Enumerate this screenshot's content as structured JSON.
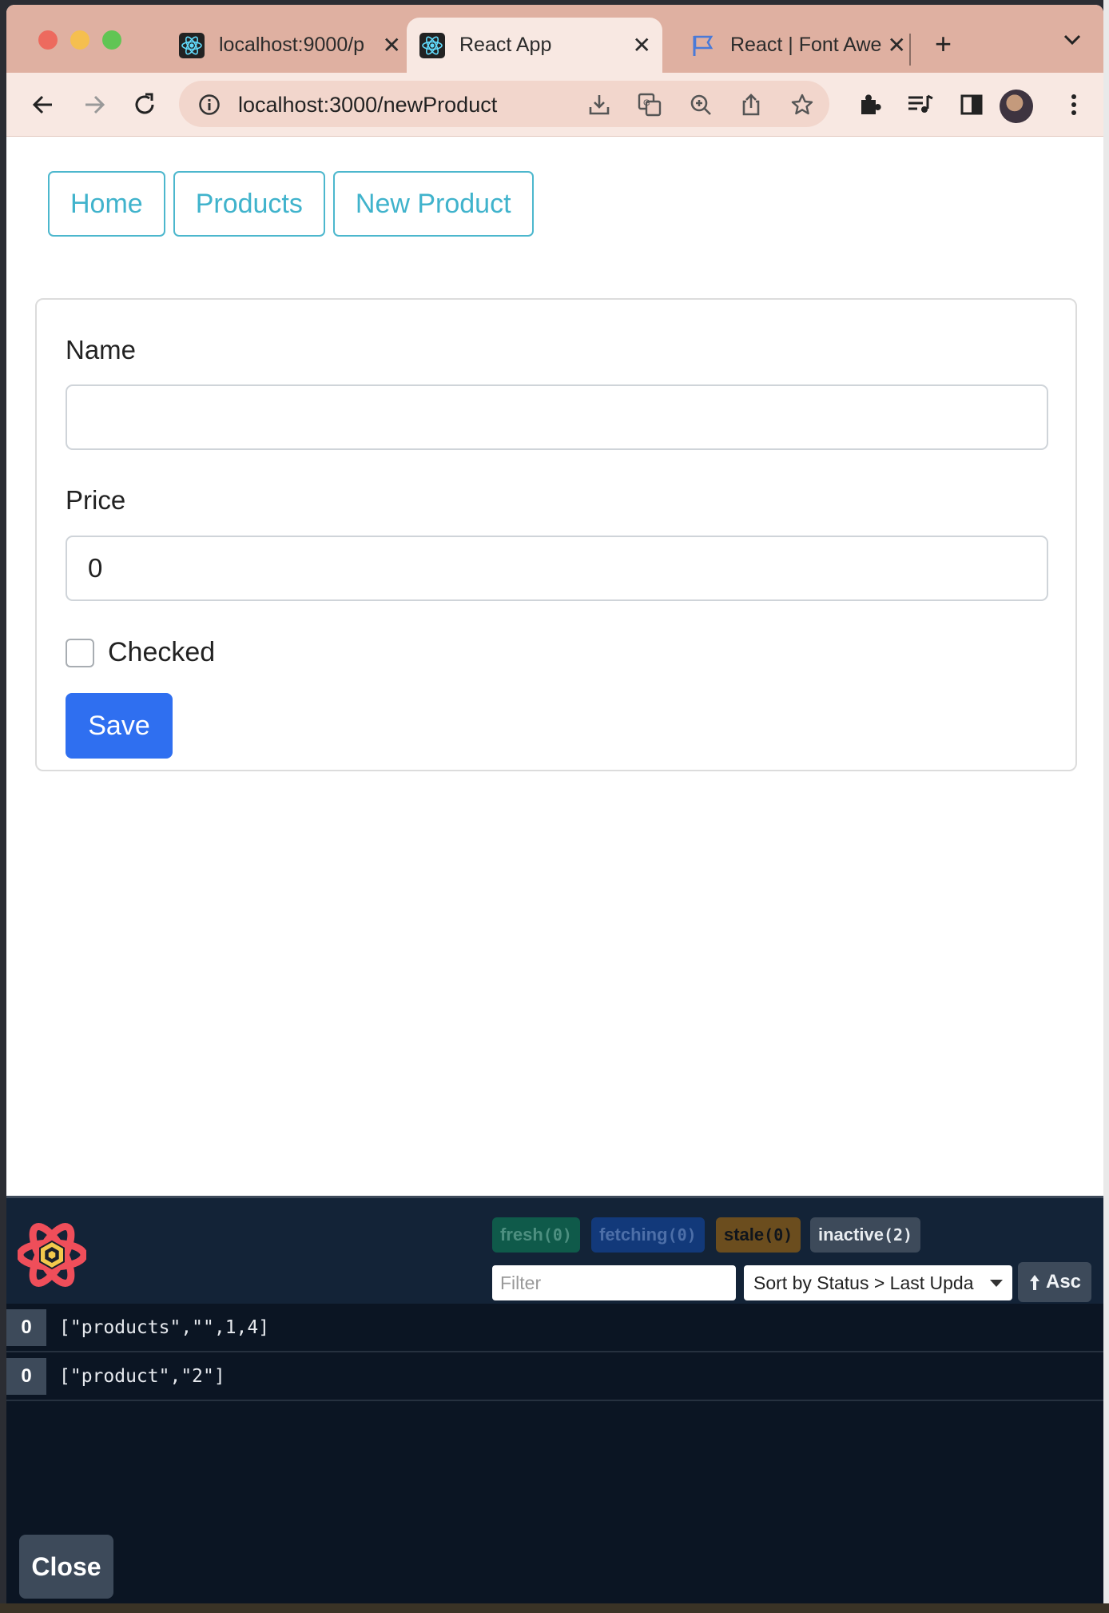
{
  "browser": {
    "tabs": [
      {
        "title": "localhost:9000/p",
        "active": false
      },
      {
        "title": "React App",
        "active": true
      },
      {
        "title": "React | Font Awe",
        "active": false
      }
    ],
    "url": "localhost:3000/newProduct"
  },
  "nav": {
    "home": "Home",
    "products": "Products",
    "new_product": "New Product"
  },
  "form": {
    "name_label": "Name",
    "name_value": "",
    "price_label": "Price",
    "price_value": "0",
    "checked_label": "Checked",
    "checked": false,
    "save_label": "Save"
  },
  "devtools": {
    "badges": [
      {
        "label": "fresh",
        "count": "(0)"
      },
      {
        "label": "fetching",
        "count": "(0)"
      },
      {
        "label": "stale",
        "count": "(0)"
      },
      {
        "label": "inactive",
        "count": "(2)"
      }
    ],
    "filter_placeholder": "Filter",
    "sort_value": "Sort by Status > Last Upda",
    "sort_dir": "Asc",
    "queries": [
      {
        "count": "0",
        "key": "[\"products\",\"\",1,4]"
      },
      {
        "count": "0",
        "key": "[\"product\",\"2\"]"
      }
    ],
    "close_label": "Close"
  },
  "colors": {
    "accent": "#2f6ff0",
    "nav_outline": "#40b3cc",
    "tabstrip": "#dfb0a1",
    "devtools_bg": "#0b1523"
  }
}
